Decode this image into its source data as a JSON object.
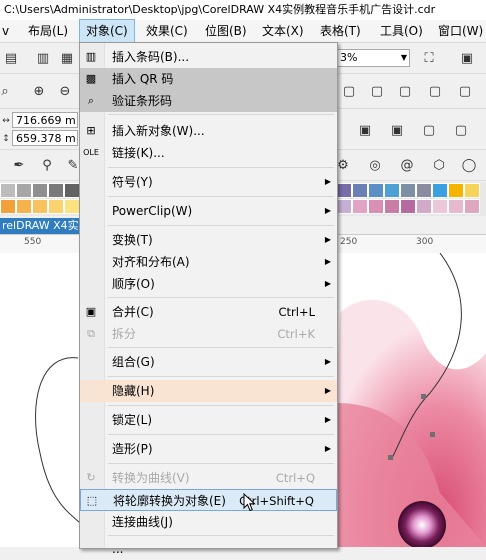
{
  "window": {
    "title": "C:\\Users\\Administrator\\Desktop\\jpg\\CorelDRAW X4实例教程音乐手机广告设计.cdr"
  },
  "menubar": {
    "items": [
      {
        "label": "v"
      },
      {
        "label": "布局(L)"
      },
      {
        "label": "对象(C)"
      },
      {
        "label": "效果(C)"
      },
      {
        "label": "位图(B)"
      },
      {
        "label": "文本(X)"
      },
      {
        "label": "表格(T)"
      },
      {
        "label": "工具(O)"
      },
      {
        "label": "窗口(W)"
      }
    ]
  },
  "toolbar": {
    "zoom_value": "3%",
    "width_value": "716.669 m",
    "height_value": "659.378 m"
  },
  "colors": {
    "accent": "#2f7dc0",
    "menu_highlight_peach": "#f9e4d3",
    "menu_highlight_gray": "#c7c7c7",
    "menu_highlight_blue": "#dbeaf7",
    "flower_pink": "#e8708a"
  },
  "document": {
    "tab_label": "relDRAW X4实例",
    "ruler_labels": [
      "550",
      "250",
      "300"
    ]
  },
  "object_menu": {
    "items": [
      {
        "label": "插入条码(B)...",
        "icon": "barcode-icon"
      },
      {
        "label": "插入 QR 码",
        "icon": "qr-code-icon"
      },
      {
        "label": "验证条形码",
        "icon": "verify-barcode-icon"
      },
      {
        "label": "插入新对象(W)...",
        "icon": "insert-object-icon"
      },
      {
        "label": "链接(K)...",
        "icon": "ole-link-icon"
      },
      {
        "label": "符号(Y)",
        "icon": ""
      },
      {
        "label": "PowerClip(W)",
        "icon": ""
      },
      {
        "label": "变换(T)",
        "icon": ""
      },
      {
        "label": "对齐和分布(A)",
        "icon": ""
      },
      {
        "label": "顺序(O)",
        "icon": ""
      },
      {
        "label": "合并(C)",
        "shortcut": "Ctrl+L",
        "icon": "combine-icon"
      },
      {
        "label": "拆分",
        "shortcut": "Ctrl+K",
        "icon": "break-apart-icon"
      },
      {
        "label": "组合(G)",
        "icon": ""
      },
      {
        "label": "隐藏(H)",
        "icon": ""
      },
      {
        "label": "锁定(L)",
        "icon": ""
      },
      {
        "label": "造形(P)",
        "icon": ""
      },
      {
        "label": "转换为曲线(V)",
        "shortcut": "Ctrl+Q",
        "icon": "convert-to-curves-icon"
      },
      {
        "label": "将轮廓转换为对象(E)",
        "shortcut": "Ctrl+Shift+Q",
        "icon": "outline-to-object-icon"
      },
      {
        "label": "连接曲线(J)",
        "icon": ""
      },
      {
        "label": "...",
        "icon": ""
      }
    ]
  }
}
